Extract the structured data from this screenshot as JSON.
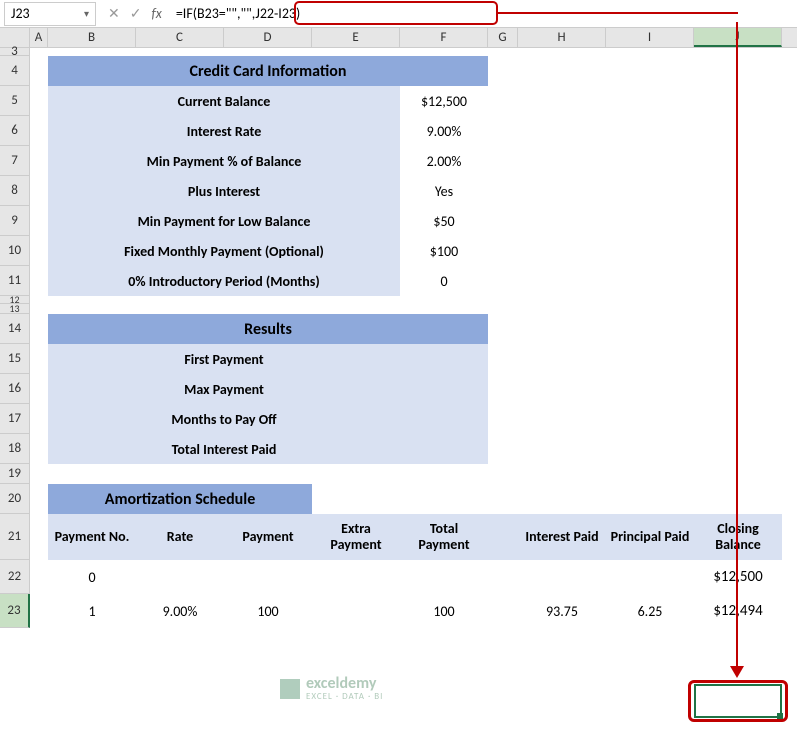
{
  "nameBox": "J23",
  "formula": "=IF(B23=\"\",\"\",J22-I23)",
  "cols": [
    "A",
    "B",
    "C",
    "D",
    "E",
    "F",
    "G",
    "H",
    "I",
    "J"
  ],
  "selectedCol": "J",
  "selectedRow": "23",
  "rows": [
    "3",
    "4",
    "5",
    "6",
    "7",
    "8",
    "9",
    "10",
    "11",
    "12",
    "13",
    "14",
    "15",
    "16",
    "17",
    "18",
    "19",
    "20",
    "21",
    "22",
    "23"
  ],
  "rowHeights": {
    "3": 8,
    "4": 30,
    "5": 30,
    "6": 30,
    "7": 30,
    "8": 30,
    "9": 30,
    "10": 30,
    "11": 30,
    "12": 8,
    "13": 10,
    "14": 30,
    "15": 30,
    "16": 30,
    "17": 30,
    "18": 30,
    "19": 20,
    "20": 30,
    "21": 46,
    "22": 34,
    "23": 34
  },
  "cc": {
    "title": "Credit Card Information",
    "labels": {
      "balance": "Current Balance",
      "rate": "Interest Rate",
      "minPct": "Min Payment % of Balance",
      "plusInt": "Plus Interest",
      "minLow": "Min Payment for Low Balance",
      "fixed": "Fixed Monthly Payment (Optional)",
      "intro": "0% Introductory Period (Months)"
    },
    "vals": {
      "balance": "$12,500",
      "rate": "9.00%",
      "minPct": "2.00%",
      "plusInt": "Yes",
      "minLow": "$50",
      "fixed": "$100",
      "intro": "0"
    }
  },
  "results": {
    "title": "Results",
    "labels": {
      "first": "First Payment",
      "max": "Max Payment",
      "months": "Months to Pay Off",
      "total": "Total Interest Paid"
    }
  },
  "amort": {
    "title": "Amortization Schedule",
    "headers": {
      "no": "Payment No.",
      "rate": "Rate",
      "payment": "Payment",
      "extra": "Extra Payment",
      "total": "Total Payment",
      "interest": "Interest Paid",
      "principal": "Principal Paid",
      "closing": "Closing Balance"
    },
    "row22": {
      "no": "0",
      "closing": "$12,500"
    },
    "row23": {
      "no": "1",
      "rate": "9.00%",
      "payment": "100",
      "extra": "",
      "total": "100",
      "interest": "93.75",
      "principal": "6.25",
      "closing": "$12,494"
    }
  },
  "watermark": {
    "name": "exceldemy",
    "tag": "EXCEL · DATA · BI"
  }
}
